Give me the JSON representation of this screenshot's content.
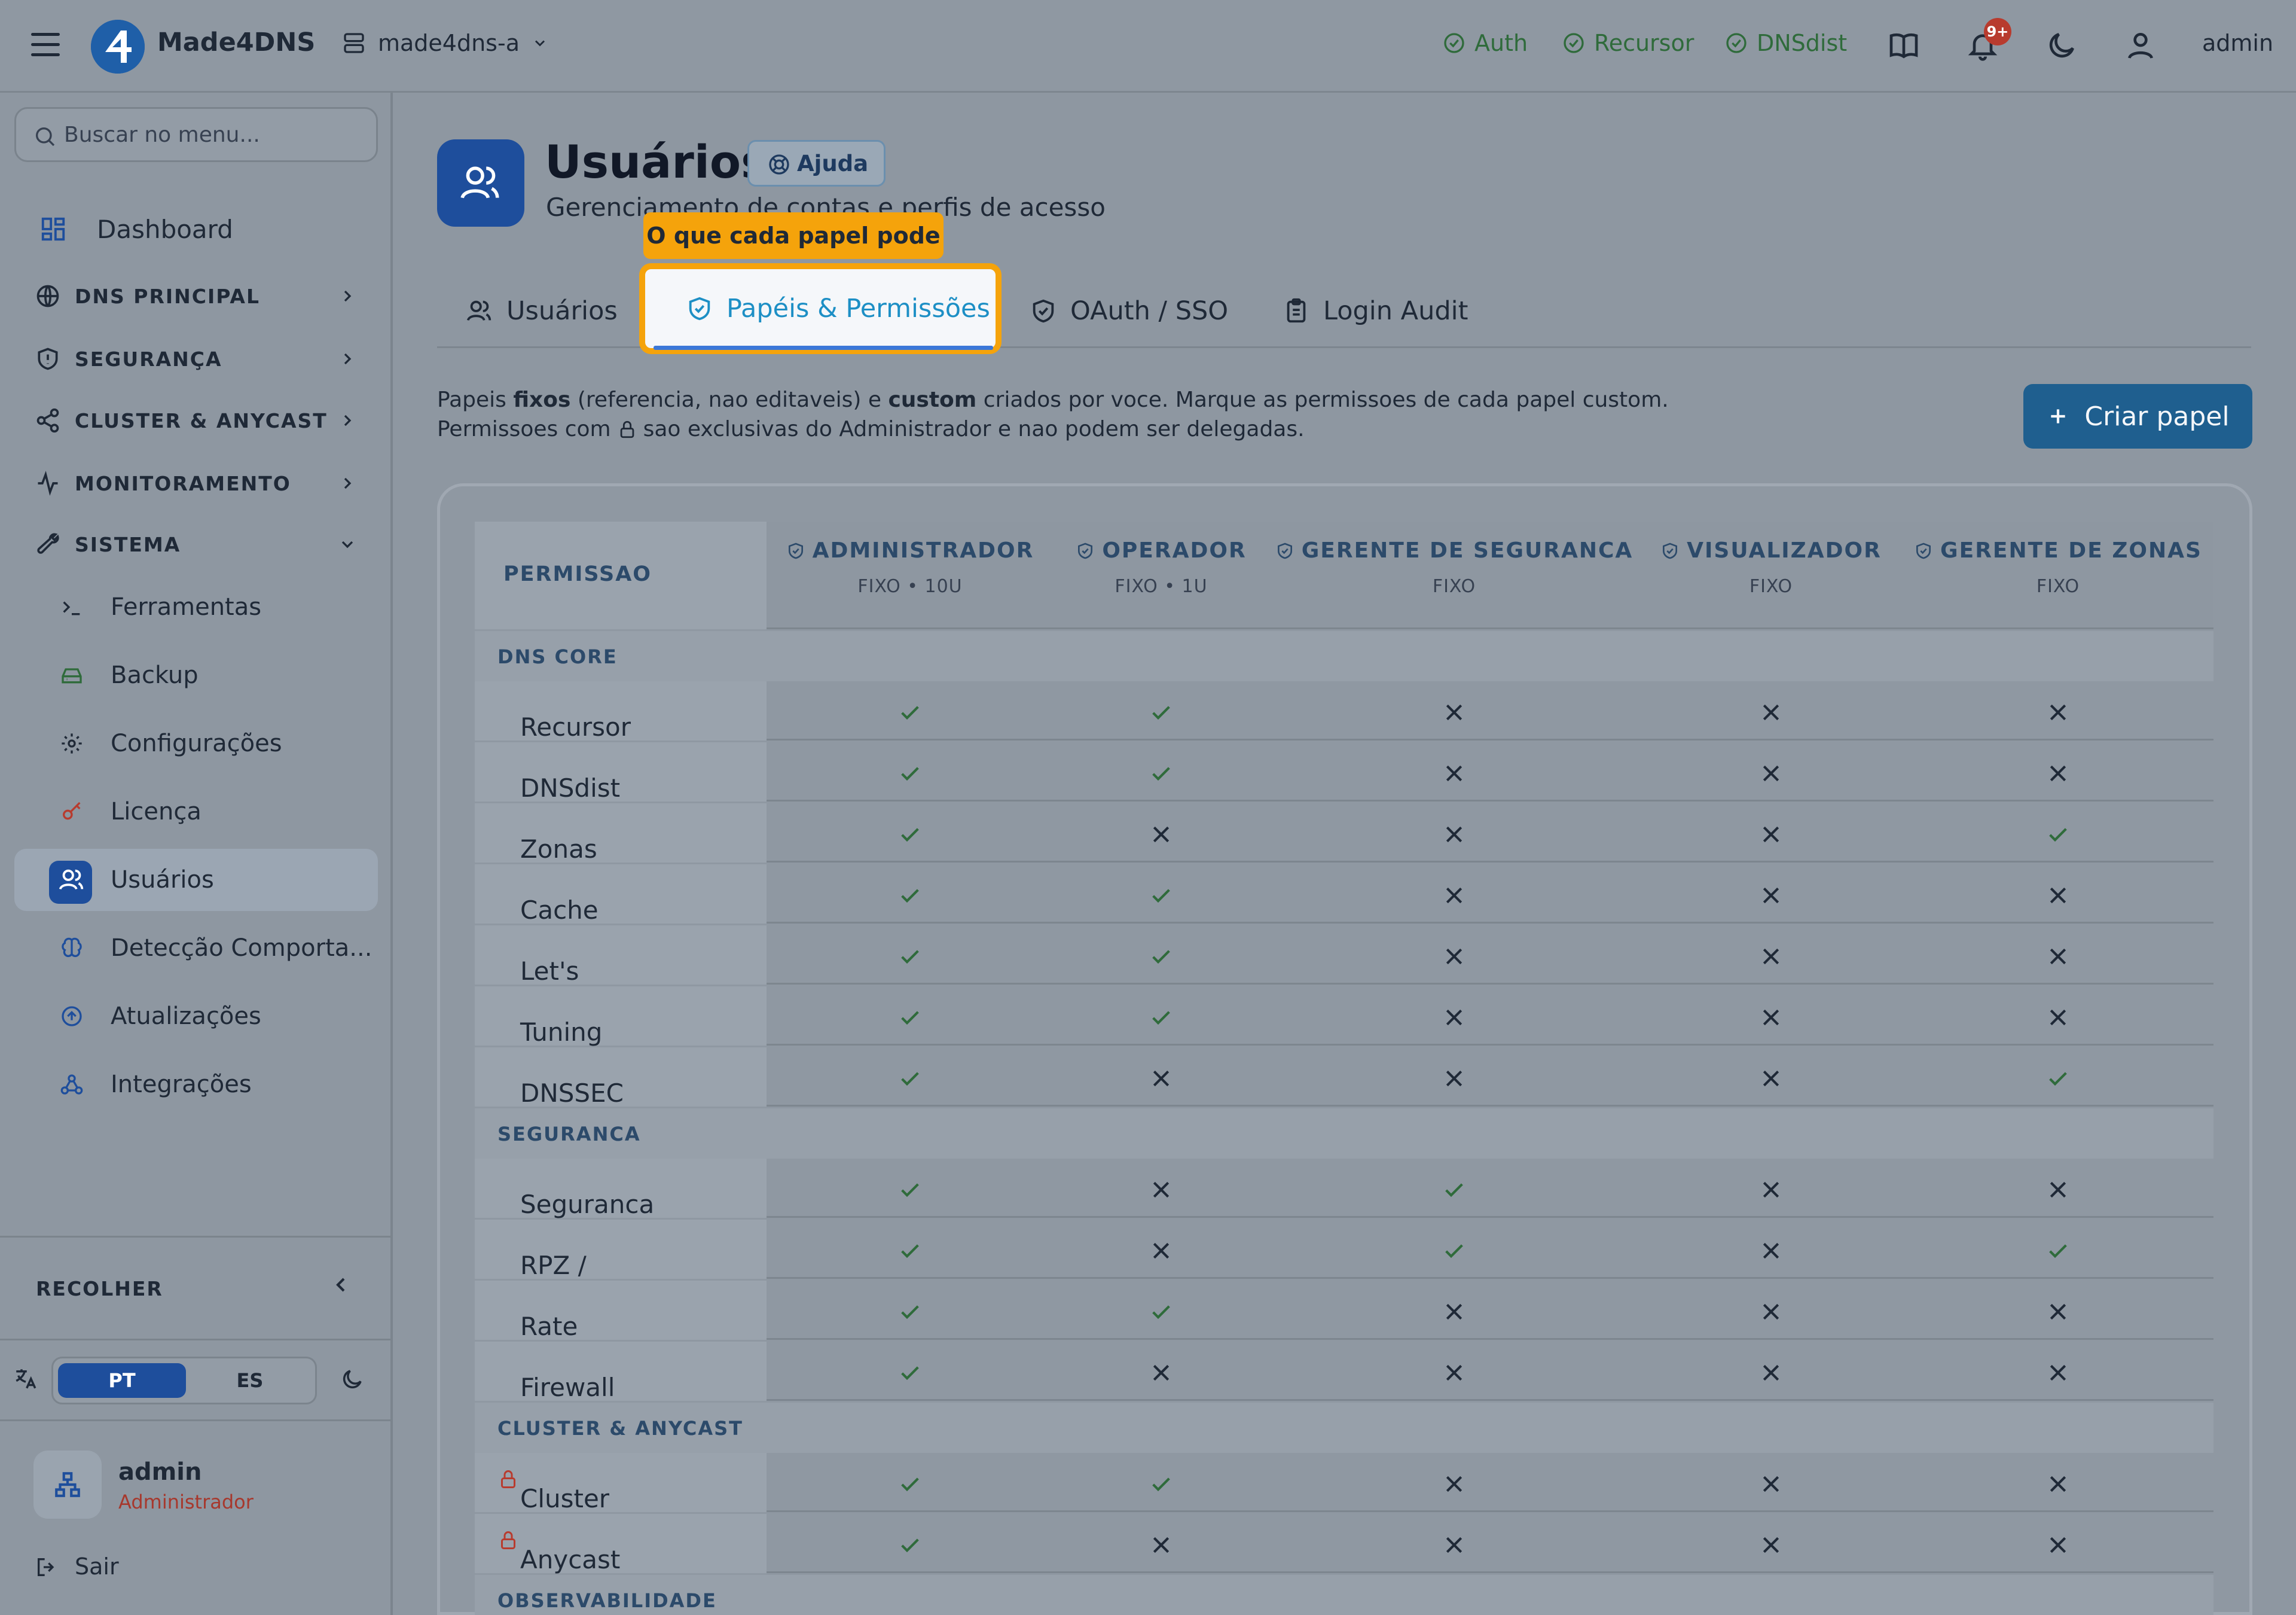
{
  "topbar": {
    "brand": "Made4DNS",
    "server": "made4dns-a",
    "services": [
      {
        "label": "Auth",
        "status": "ok"
      },
      {
        "label": "Recursor",
        "status": "ok"
      },
      {
        "label": "DNSdist",
        "status": "ok"
      }
    ],
    "notifications_badge": "9+",
    "user": "admin"
  },
  "sidebar": {
    "search_placeholder": "Buscar no menu...",
    "dashboard": "Dashboard",
    "sections": [
      "DNS PRINCIPAL",
      "SEGURANÇA",
      "CLUSTER & ANYCAST",
      "MONITORAMENTO",
      "SISTEMA"
    ],
    "system_items": [
      "Ferramentas",
      "Backup",
      "Configurações",
      "Licença",
      "Usuários",
      "Detecção Comporta...",
      "Atualizações",
      "Integrações"
    ],
    "active_item": "Usuários",
    "collapse_label": "RECOLHER",
    "lang_pt": "PT",
    "lang_es": "ES",
    "user_name": "admin",
    "user_role": "Administrador",
    "logout": "Sair"
  },
  "page": {
    "title": "Usuários",
    "help": "Ajuda",
    "subtitle": "Gerenciamento de contas e perfis de acesso",
    "tooltip": "O que cada papel pode",
    "tabs": [
      "Usuários",
      "Papéis & Permissões",
      "OAuth / SSO",
      "Login Audit"
    ],
    "active_tab": "Papéis & Permissões",
    "desc_line1_parts": [
      "Papeis ",
      "fixos",
      " (referencia, nao editaveis) e ",
      "custom",
      " criados por voce. Marque as permissoes de cada papel custom."
    ],
    "desc_line2_a": "Permissoes com",
    "desc_line2_b": "sao exclusivas do Administrador e nao podem ser delegadas.",
    "create_button": "Criar papel"
  },
  "table": {
    "perm_header": "PERMISSAO",
    "roles": [
      {
        "name": "ADMINISTRADOR",
        "meta": "FIXO • 10U"
      },
      {
        "name": "OPERADOR",
        "meta": "FIXO • 1U"
      },
      {
        "name": "GERENTE DE SEGURANCA",
        "meta": "FIXO"
      },
      {
        "name": "VISUALIZADOR",
        "meta": "FIXO"
      },
      {
        "name": "GERENTE DE ZONAS",
        "meta": "FIXO"
      }
    ],
    "groups": [
      {
        "name": "DNS CORE",
        "rows": [
          {
            "perm": "Recursor",
            "locked": false,
            "values": [
              true,
              true,
              false,
              false,
              false
            ]
          },
          {
            "perm": "DNSdist",
            "locked": false,
            "values": [
              true,
              true,
              false,
              false,
              false
            ]
          },
          {
            "perm": "Zonas",
            "locked": false,
            "values": [
              true,
              false,
              false,
              false,
              true
            ]
          },
          {
            "perm": "Cache Viewer",
            "locked": false,
            "values": [
              true,
              true,
              false,
              false,
              false
            ]
          },
          {
            "perm": "Let's Encrypt",
            "locked": false,
            "values": [
              true,
              true,
              false,
              false,
              false
            ]
          },
          {
            "perm": "Tuning",
            "locked": false,
            "values": [
              true,
              true,
              false,
              false,
              false
            ]
          },
          {
            "perm": "DNSSEC",
            "locked": false,
            "values": [
              true,
              false,
              false,
              false,
              true
            ]
          }
        ]
      },
      {
        "name": "SEGURANCA",
        "rows": [
          {
            "perm": "Seguranca",
            "locked": false,
            "values": [
              true,
              false,
              true,
              false,
              false
            ]
          },
          {
            "perm": "RPZ / Bloqueio",
            "locked": false,
            "values": [
              true,
              false,
              true,
              false,
              true
            ]
          },
          {
            "perm": "Rate Limiting",
            "locked": false,
            "values": [
              true,
              true,
              false,
              false,
              false
            ]
          },
          {
            "perm": "Firewall",
            "locked": false,
            "values": [
              true,
              false,
              false,
              false,
              false
            ]
          }
        ]
      },
      {
        "name": "CLUSTER & ANYCAST",
        "rows": [
          {
            "perm": "Cluster",
            "locked": true,
            "values": [
              true,
              true,
              false,
              false,
              false
            ]
          },
          {
            "perm": "Anycast",
            "locked": true,
            "values": [
              true,
              false,
              false,
              false,
              false
            ]
          }
        ]
      },
      {
        "name": "OBSERVABILIDADE",
        "rows": []
      }
    ]
  },
  "colors": {
    "check": "#2f6b3b",
    "cross": "#1f2937",
    "accent": "#1e4e9c",
    "highlight": "#f5a30b",
    "lock": "#b83b2e"
  }
}
